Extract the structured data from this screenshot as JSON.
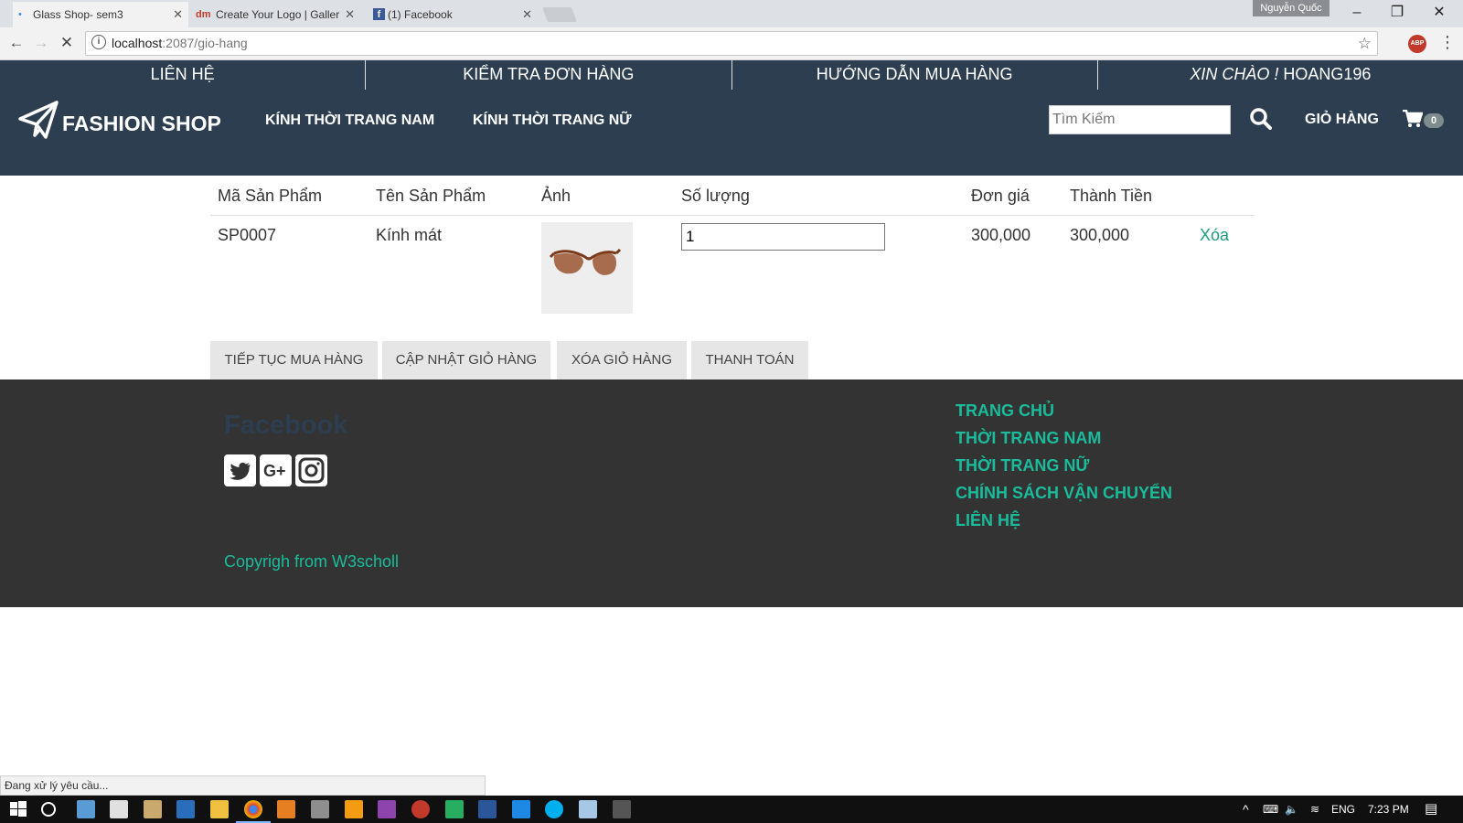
{
  "browser": {
    "tabs": [
      {
        "title": "Glass Shop- sem3",
        "icon": "loading-icon"
      },
      {
        "title": "Create Your Logo | Galler",
        "icon": "dm-icon"
      },
      {
        "title": "(1) Facebook",
        "icon": "facebook-icon"
      }
    ],
    "profile_name": "Nguyễn Quốc",
    "url_host": "localhost",
    "url_rest": ":2087/gio-hang",
    "status_text": "Đang xử lý yêu cầu..."
  },
  "topbar": {
    "contact": "LIÊN HỆ",
    "check_order": "KIỂM TRA ĐƠN HÀNG",
    "buy_guide": "HƯỚNG DẪN MUA HÀNG",
    "greeting_italic": "XIN CHÀO !",
    "greeting_user": " HOANG196"
  },
  "header": {
    "logo_text": "FASHION SHOP",
    "nav_men": "KÍNH THỜI TRANG NAM",
    "nav_women": "KÍNH THỜI TRANG NỮ",
    "search_placeholder": "Tìm Kiếm",
    "cart_label": "GIỎ HÀNG",
    "cart_count": "0"
  },
  "cart": {
    "columns": [
      "Mã Sản Phẩm",
      "Tên Sản Phẩm",
      "Ảnh",
      "Số lượng",
      "Đơn giá",
      "Thành Tiền"
    ],
    "items": [
      {
        "code": "SP0007",
        "name": "Kính mát",
        "quantity": "1",
        "unit_price": "300,000",
        "total": "300,000",
        "delete": "Xóa"
      }
    ],
    "buttons": {
      "continue": "TIẾP TỤC MUA HÀNG",
      "update": "CẬP NHẬT GIỎ HÀNG",
      "clear": "XÓA GIỎ HÀNG",
      "checkout": "THANH TOÁN"
    }
  },
  "footer": {
    "facebook_title": "Facebook",
    "copyright": "Copyrigh from W3scholl",
    "links": [
      "TRANG CHỦ",
      "THỜI TRANG NAM",
      "THỜI TRANG NỮ",
      "CHÍNH SÁCH VẬN CHUYỂN",
      "LIÊN HỆ"
    ]
  },
  "taskbar": {
    "language": "ENG",
    "time": "7:23 PM"
  }
}
